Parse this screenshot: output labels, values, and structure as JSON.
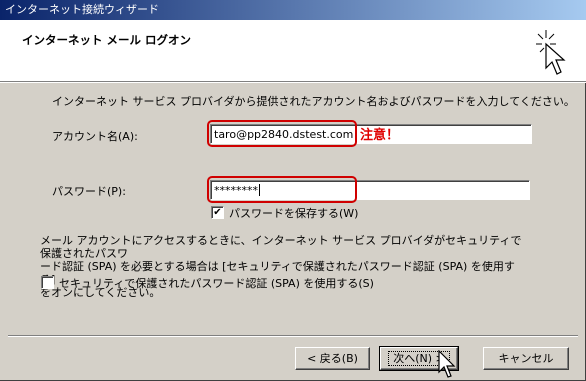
{
  "window": {
    "title": "インターネット接続ウィザード"
  },
  "header": {
    "title": "インターネット メール ログオン",
    "icon": "wizard-sparkle-icon"
  },
  "intro": "インターネット サービス プロバイダから提供されたアカウント名およびパスワードを入力してください。",
  "account": {
    "label": "アカウント名(A):",
    "value": "taro@pp2840.dstest.com"
  },
  "note": "注意！",
  "password": {
    "label": "パスワード(P):",
    "value": "********"
  },
  "save_password": {
    "label": "パスワードを保存する(W)",
    "checked": true
  },
  "description": [
    "メール アカウントにアクセスするときに、インターネット サービス プロバイダがセキュリティで保護されたパスワ",
    "ード認証 (SPA) を必要とする場合は [セキュリティで保護されたパスワード認証 (SPA) を使用する]",
    "をオンにしてください。"
  ],
  "spa": {
    "label": "セキュリティで保護されたパスワード認証 (SPA) を使用する(S)",
    "checked": false
  },
  "buttons": {
    "back": "< 戻る(B)",
    "next": "次へ(N) >",
    "cancel": "キャンセル"
  },
  "colors": {
    "highlight": "#d00000",
    "titlebar": "#0a246a"
  }
}
